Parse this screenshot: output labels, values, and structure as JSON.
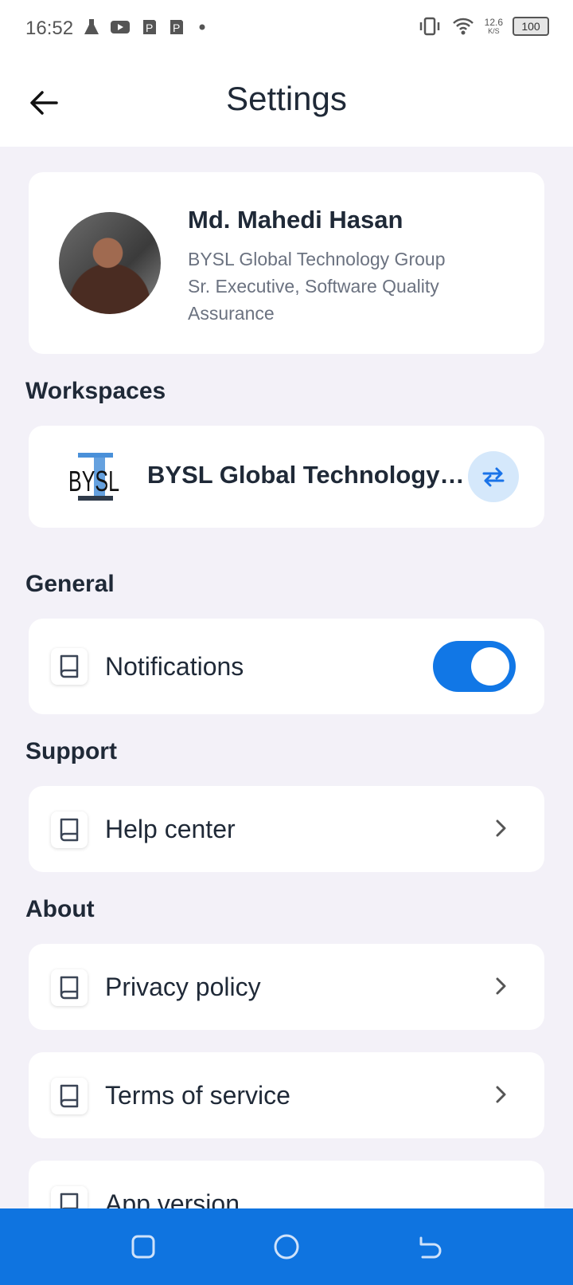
{
  "status_bar": {
    "time": "16:52",
    "netspeed_value": "12.6",
    "netspeed_unit": "K/S",
    "battery": "100"
  },
  "header": {
    "title": "Settings"
  },
  "profile": {
    "name": "Md. Mahedi Hasan",
    "company": "BYSL Global Technology Group",
    "role": "Sr. Executive, Software Quality Assurance"
  },
  "workspaces": {
    "section_title": "Workspaces",
    "logo_text": "BYSL",
    "current": "BYSL Global Technology Group"
  },
  "general": {
    "section_title": "General",
    "notifications_label": "Notifications",
    "notifications_enabled": true
  },
  "support": {
    "section_title": "Support",
    "help_center_label": "Help center"
  },
  "about": {
    "section_title": "About",
    "privacy_label": "Privacy policy",
    "terms_label": "Terms of service",
    "app_version_label": "App version"
  },
  "colors": {
    "accent": "#1177e6",
    "navbar": "#0f74e0",
    "background": "#f3f1f8"
  }
}
